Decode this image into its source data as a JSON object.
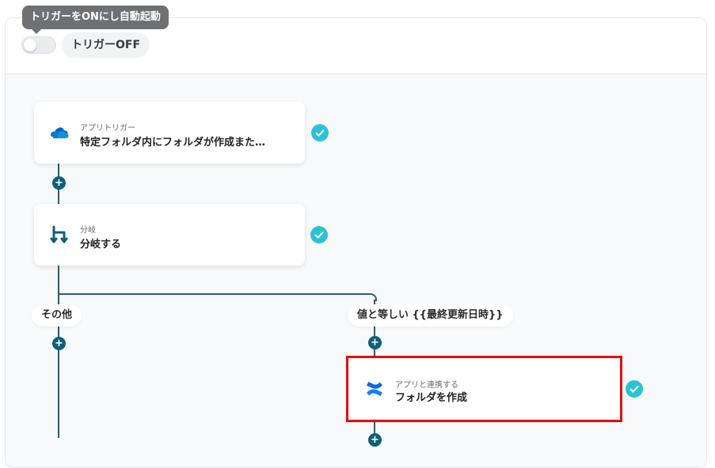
{
  "tooltip": "トリガーをONにし自動起動",
  "trigger_toggle": {
    "label": "トリガーOFF",
    "state": "off"
  },
  "steps": [
    {
      "subtitle": "アプリトリガー",
      "title": "特定フォルダ内にフォルダが作成また…",
      "icon": "onedrive-icon",
      "status": "check-icon"
    },
    {
      "subtitle": "分岐",
      "title": "分岐する",
      "icon": "branch-icon",
      "status": "check-icon"
    },
    {
      "subtitle": "アプリと連携する",
      "title": "フォルダを作成",
      "icon": "confluence-icon",
      "status": "check-icon"
    }
  ],
  "branches": {
    "other": "その他",
    "equals": "値と等しい {{最終更新日時}}"
  },
  "colors": {
    "line": "#2f5b6f",
    "plus": "#0f5f78",
    "check": "#2cc2d6",
    "highlight": "#e01010"
  }
}
